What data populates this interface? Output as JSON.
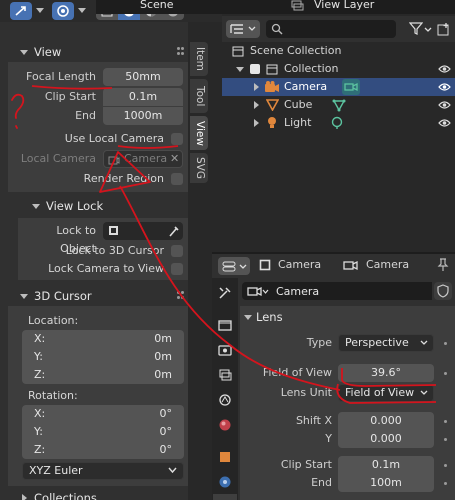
{
  "header": {
    "scene": "Scene",
    "view_layer": "View Layer"
  },
  "side_tabs": [
    "Item",
    "Tool",
    "View",
    "SVG"
  ],
  "view_panel": {
    "title": "View",
    "focal_length": {
      "label": "Focal Length",
      "value": "50mm"
    },
    "clip_start": {
      "label": "Clip Start",
      "value": "0.1m"
    },
    "clip_end": {
      "label": "End",
      "value": "1000m"
    },
    "use_local_camera": "Use Local Camera",
    "local_camera": {
      "label": "Local Camera",
      "value": "Camera"
    },
    "render_region": "Render Region",
    "view_lock": {
      "title": "View Lock",
      "lock_to_object": "Lock to Object",
      "lock_3d_cursor": "Lock to 3D Cursor",
      "lock_camera": "Lock Camera to View"
    }
  },
  "cursor_panel": {
    "title": "3D Cursor",
    "location_label": "Location:",
    "location": [
      {
        "axis": "X:",
        "value": "0m"
      },
      {
        "axis": "Y:",
        "value": "0m"
      },
      {
        "axis": "Z:",
        "value": "0m"
      }
    ],
    "rotation_label": "Rotation:",
    "rotation": [
      {
        "axis": "X:",
        "value": "0°"
      },
      {
        "axis": "Y:",
        "value": "0°"
      },
      {
        "axis": "Z:",
        "value": "0°"
      }
    ],
    "mode": "XYZ Euler"
  },
  "collections_panel": {
    "title": "Collections"
  },
  "outliner": {
    "search_placeholder": "",
    "root": "Scene Collection",
    "collection": "Collection",
    "items": [
      "Camera",
      "Cube",
      "Light"
    ]
  },
  "properties": {
    "header_object": "Camera",
    "header_data": "Camera",
    "datablock_name": "Camera",
    "lens_title": "Lens",
    "type": {
      "label": "Type",
      "value": "Perspective"
    },
    "fov": {
      "label": "Field of View",
      "value": "39.6°"
    },
    "lens_unit": {
      "label": "Lens Unit",
      "value": "Field of View"
    },
    "shift_x": {
      "label": "Shift X",
      "value": "0.000"
    },
    "shift_y": {
      "label": "Y",
      "value": "0.000"
    },
    "clip_start": {
      "label": "Clip Start",
      "value": "0.1m"
    },
    "clip_end": {
      "label": "End",
      "value": "100m"
    }
  },
  "annotation": {
    "text": "?"
  },
  "colors": {
    "selected_row": "#334d80",
    "annotation": "#d4141d",
    "camera_orange": "#e0873c",
    "data_green": "#5cc4a0"
  }
}
